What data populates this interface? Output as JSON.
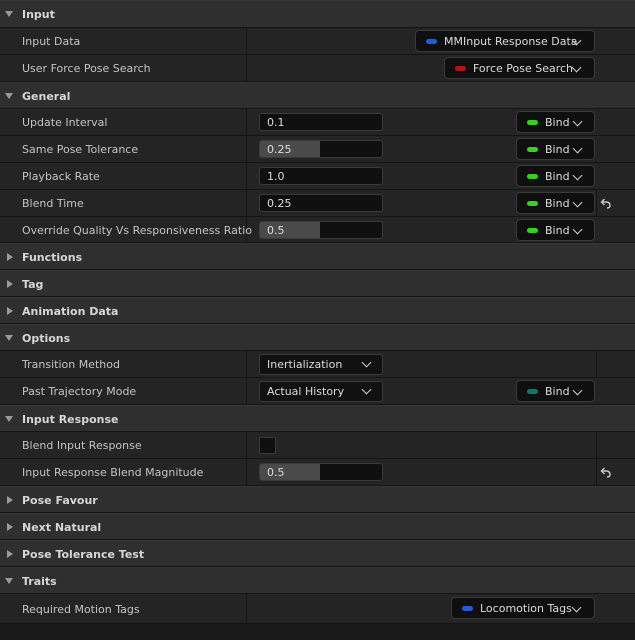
{
  "colors": {
    "pill_blue": "#1f5fd6",
    "pill_red": "#b41414",
    "pill_green": "#36d11a",
    "pill_teal": "#13766b"
  },
  "categories": {
    "input": "Input",
    "general": "General",
    "functions": "Functions",
    "tag": "Tag",
    "animation_data": "Animation Data",
    "options": "Options",
    "input_response": "Input Response",
    "pose_favour": "Pose Favour",
    "next_natural": "Next Natural",
    "pose_tolerance_test": "Pose Tolerance Test",
    "traits": "Traits"
  },
  "input": {
    "input_data_label": "Input Data",
    "input_data_value": "MMInput Response Data",
    "user_force_label": "User Force Pose Search",
    "user_force_value": "Force Pose Search"
  },
  "general": {
    "bind_label": "Bind",
    "update_interval_label": "Update Interval",
    "update_interval_value": "0.1",
    "same_pose_label": "Same Pose Tolerance",
    "same_pose_value": "0.25",
    "same_pose_fill": 0.5,
    "playback_rate_label": "Playback Rate",
    "playback_rate_value": "1.0",
    "blend_time_label": "Blend Time",
    "blend_time_value": "0.25",
    "override_label": "Override Quality Vs Responsiveness Ratio",
    "override_value": "0.5",
    "override_fill": 0.5
  },
  "options": {
    "transition_method_label": "Transition Method",
    "transition_method_value": "Inertialization",
    "past_trajectory_label": "Past Trajectory Mode",
    "past_trajectory_value": "Actual History",
    "bind_label": "Bind"
  },
  "input_response": {
    "blend_input_label": "Blend Input Response",
    "blend_input_checked": false,
    "magnitude_label": "Input Response Blend Magnitude",
    "magnitude_value": "0.5",
    "magnitude_fill": 0.5
  },
  "traits": {
    "required_tags_label": "Required Motion Tags",
    "required_tags_value": "Locomotion Tags"
  }
}
